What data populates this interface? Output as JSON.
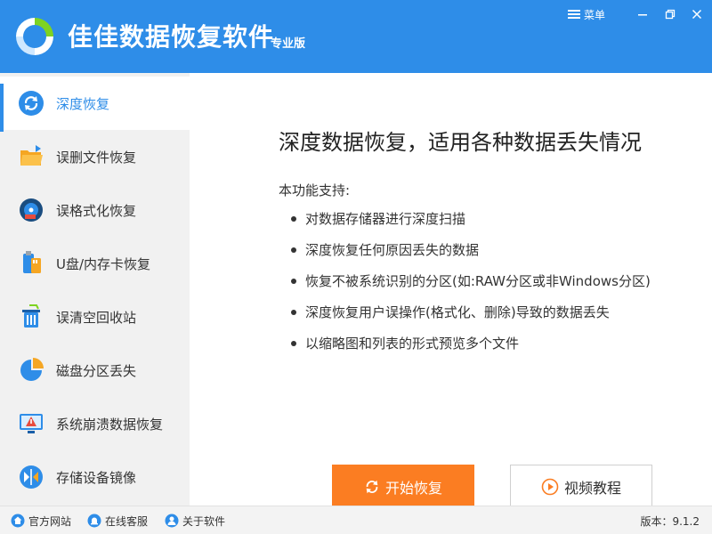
{
  "header": {
    "title": "佳佳数据恢复软件",
    "edition": "专业版",
    "menu_label": "菜单",
    "accent_color": "#2e8de8"
  },
  "sidebar": {
    "items": [
      {
        "label": "深度恢复",
        "icon": "refresh-icon",
        "active": true
      },
      {
        "label": "误删文件恢复",
        "icon": "folder-icon",
        "active": false
      },
      {
        "label": "误格式化恢复",
        "icon": "disk-icon",
        "active": false
      },
      {
        "label": "U盘/内存卡恢复",
        "icon": "usb-sd-icon",
        "active": false
      },
      {
        "label": "误清空回收站",
        "icon": "recycle-bin-icon",
        "active": false
      },
      {
        "label": "磁盘分区丢失",
        "icon": "pie-partition-icon",
        "active": false
      },
      {
        "label": "系统崩溃数据恢复",
        "icon": "monitor-warning-icon",
        "active": false
      },
      {
        "label": "存储设备镜像",
        "icon": "mirror-icon",
        "active": false
      }
    ]
  },
  "main": {
    "title": "深度数据恢复，适用各种数据丢失情况",
    "support_label": "本功能支持:",
    "bullets": [
      "对数据存储器进行深度扫描",
      "深度恢复任何原因丢失的数据",
      "恢复不被系统识别的分区(如:RAW分区或非Windows分区)",
      "深度恢复用户误操作(格式化、删除)导致的数据丢失",
      "以缩略图和列表的形式预览多个文件"
    ],
    "start_button": "开始恢复",
    "video_button": "视频教程",
    "start_color": "#fb7d22"
  },
  "footer": {
    "links": [
      "官方网站",
      "在线客服",
      "关于软件"
    ],
    "version": "版本：9.1.2"
  }
}
